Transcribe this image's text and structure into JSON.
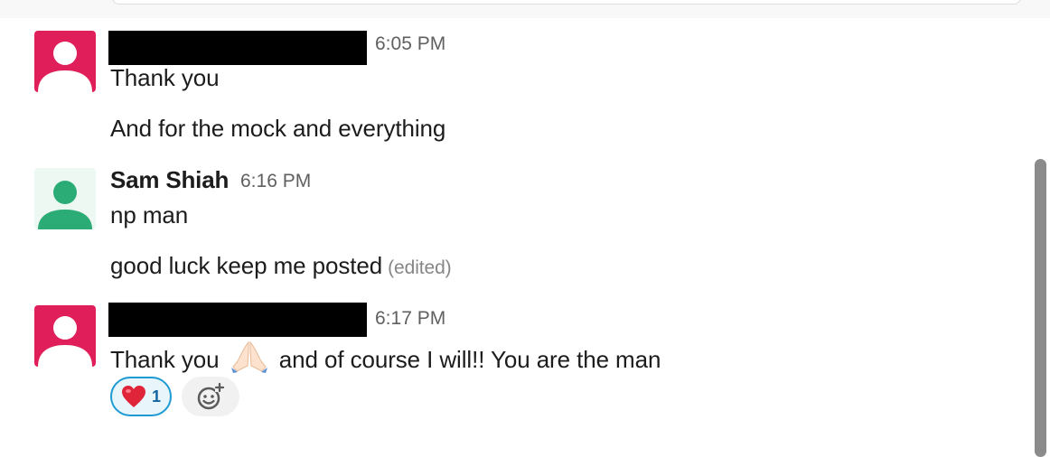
{
  "messages": [
    {
      "sender": "",
      "sender_redacted": true,
      "time": "6:05 PM",
      "avatar": "person-icon",
      "lines": [
        "Thank you",
        "And for the mock and everything"
      ]
    },
    {
      "sender": "Sam Shiah",
      "sender_redacted": false,
      "time": "6:16 PM",
      "avatar": "person-icon",
      "lines": [
        "np man",
        "good luck keep me posted"
      ],
      "edited_label": "(edited)"
    },
    {
      "sender": "",
      "sender_redacted": true,
      "time": "6:17 PM",
      "avatar": "person-icon",
      "text_before_emoji": "Thank you",
      "emoji": "folded-hands-emoji",
      "text_after_emoji": "and of course I will!! You are the man",
      "reactions": [
        {
          "emoji": "red-heart-emoji",
          "count": "1"
        }
      ]
    }
  ],
  "colors": {
    "avatar_pink": "#e01e5a",
    "avatar_green": "#2bac76",
    "reaction_border": "#1d9bd1",
    "reaction_count": "#1264a3"
  },
  "icons": {
    "add_reaction": "add-reaction-icon"
  }
}
